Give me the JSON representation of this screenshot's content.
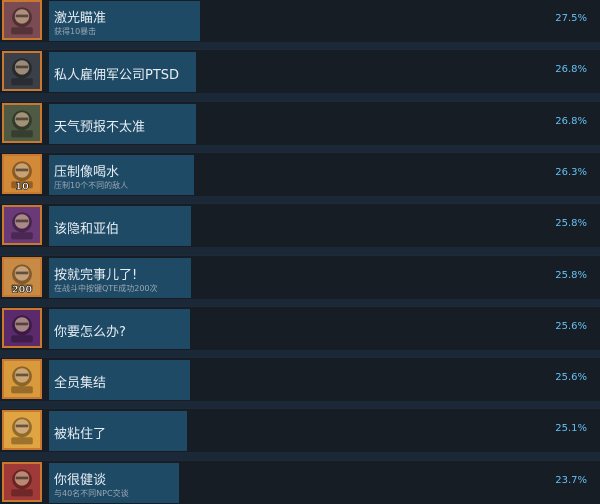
{
  "achievements": [
    {
      "title": "激光瞄准",
      "desc": "获得10暴击",
      "percent": "27.5%",
      "bar": 0.275,
      "icon": "laser-rifle-icon",
      "bg": "#7a4b52"
    },
    {
      "title": "私人雇佣军公司PTSD",
      "desc": "",
      "percent": "26.8%",
      "bar": 0.268,
      "icon": "masked-soldier-icon",
      "bg": "#3b3f48"
    },
    {
      "title": "天气预报不太准",
      "desc": "",
      "percent": "26.8%",
      "bar": 0.268,
      "icon": "bearded-man-icon",
      "bg": "#4e5a44"
    },
    {
      "title": "压制像喝水",
      "desc": "压制10个不同的敌人",
      "percent": "26.3%",
      "bar": 0.263,
      "icon": "fist-10-icon",
      "bg": "#d28a38",
      "badge": "10"
    },
    {
      "title": "该隐和亚伯",
      "desc": "",
      "percent": "25.8%",
      "bar": 0.258,
      "icon": "purple-bandana-brute-icon",
      "bg": "#6a3a78"
    },
    {
      "title": "按就完事儿了!",
      "desc": "在战斗中按键QTE成功200次",
      "percent": "25.8%",
      "bar": 0.258,
      "icon": "punching-fist-200-icon",
      "bg": "#c88b45",
      "badge": "200"
    },
    {
      "title": "你要怎么办?",
      "desc": "",
      "percent": "25.6%",
      "bar": 0.256,
      "icon": "purple-bandana-brute-icon",
      "bg": "#5b2a6a"
    },
    {
      "title": "全员集结",
      "desc": "",
      "percent": "25.6%",
      "bar": 0.256,
      "icon": "squad-huddle-icon",
      "bg": "#d89a3c"
    },
    {
      "title": "被粘住了",
      "desc": "",
      "percent": "25.1%",
      "bar": 0.251,
      "icon": "crocodile-icon",
      "bg": "#e0a542"
    },
    {
      "title": "你很健谈",
      "desc": "与40名不同NPC交谈",
      "percent": "23.7%",
      "bar": 0.237,
      "icon": "totem-mask-icon",
      "bg": "#a03a38"
    }
  ]
}
